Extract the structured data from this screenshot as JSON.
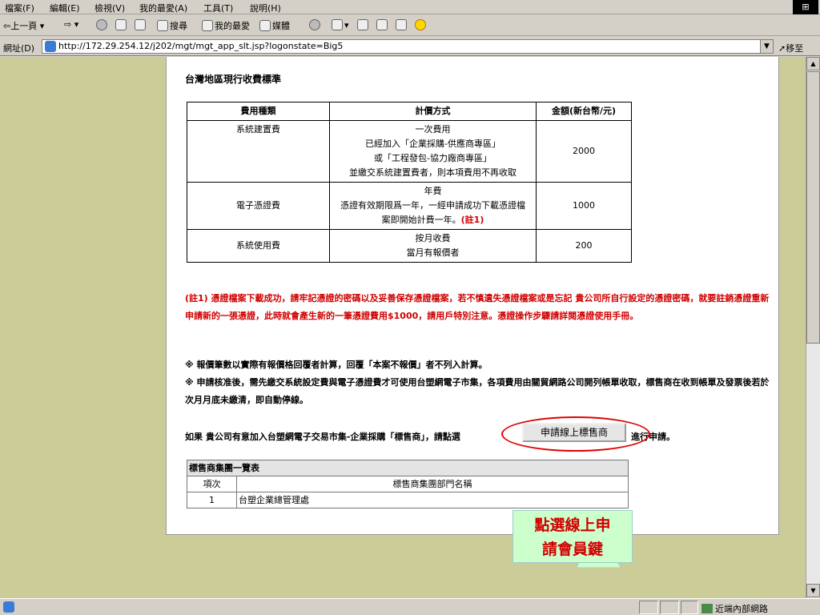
{
  "menu": {
    "items": [
      "檔案(F)",
      "編輯(E)",
      "檢視(V)",
      "我的最愛(A)",
      "工具(T)",
      "說明(H)"
    ]
  },
  "toolbar": {
    "back": "⇦上一頁",
    "search": "搜尋",
    "favorites": "我的最愛",
    "media": "媒體"
  },
  "address": {
    "label": "網址(D)",
    "url": "http://172.29.254.12/j202/mgt/mgt_app_slt.jsp?logonstate=Big5",
    "go": "移至"
  },
  "page": {
    "title": "台灣地區現行收費標準",
    "fee_table": {
      "headers": [
        "費用種類",
        "計價方式",
        "金額(新台幣/元)"
      ],
      "rows": [
        {
          "type": "系統建置費",
          "method_lines": [
            "一次費用",
            "已經加入「企業採購-供應商專區」",
            "或「工程發包-協力廠商專區」",
            "並繳交系統建置費者，則本項費用不再收取"
          ],
          "amount": "2000"
        },
        {
          "type": "電子憑證費",
          "method_lines": [
            "年費",
            "憑證有效期限爲一年，一經申請成功下載憑證檔",
            "案即開始計費一年。"
          ],
          "note": "(註1)",
          "amount": "1000"
        },
        {
          "type": "系統使用費",
          "method_lines": [
            "按月收費",
            "當月有報價者"
          ],
          "amount": "200"
        }
      ]
    },
    "red_note": "(註1) 憑證檔案下載成功，請牢記憑證的密碼以及妥善保存憑證檔案，若不慎遺失憑證檔案或是忘記 貴公司所自行設定的憑證密碼，就要註銷憑證重新申請新的一張憑證，此時就會產生新的一筆憑證費用$1000，請用戶特別注意。憑證操作步驟請詳閱憑證使用手冊。",
    "rule1": "※ 報價筆數以實際有報價格回覆者計算，回覆「本案不報價」者不列入計算。",
    "rule2": "※ 申請核准後，需先繳交系統設定費與電子憑證費才可使用台塑網電子市集，各項費用由關貿網路公司開列帳單收取，標售商在收到帳單及發票後若於次月月底未繳清，即自動停線。",
    "apply_before": "如果 貴公司有意加入台塑網電子交易市集-企業採購「標售商」，請點選",
    "apply_button": "申請線上標售商",
    "apply_after": "進行申請。",
    "group_table": {
      "caption": "標售商集團一覽表",
      "headers": [
        "項次",
        "標售商集團部門名稱"
      ],
      "rows": [
        [
          "1",
          "台塑企業總管理處"
        ]
      ]
    },
    "callout": "點選線上申請會員鍵"
  },
  "status": {
    "zone": "近端內部網路"
  },
  "colors": {
    "page_bg": "#cccc99",
    "note_red": "#d00000",
    "callout_bg": "#ccffcc"
  }
}
